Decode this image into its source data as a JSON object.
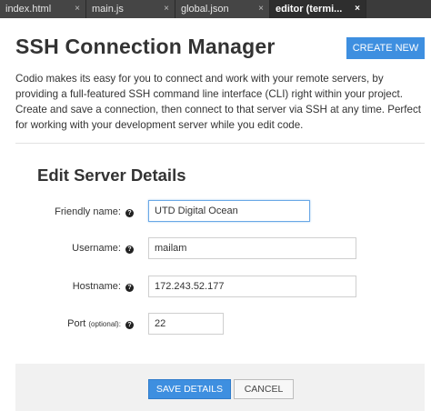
{
  "tabs": [
    {
      "label": "index.html",
      "close": "×",
      "active": false
    },
    {
      "label": "main.js",
      "close": "×",
      "active": false
    },
    {
      "label": "global.json",
      "close": "×",
      "active": false
    },
    {
      "label": "editor (termi...",
      "close": "×",
      "active": true
    }
  ],
  "header": {
    "title": "SSH Connection Manager",
    "create_label": "CREATE NEW"
  },
  "intro": "Codio makes its easy for you to connect and work with your remote servers, by providing a full-featured SSH command line interface (CLI) right within your project. Create and save a connection, then connect to that server via SSH at any time. Perfect for working with your development server while you edit code.",
  "form": {
    "title": "Edit Server Details",
    "help_glyph": "?",
    "friendly_name": {
      "label": "Friendly name:",
      "value": "UTD Digital Ocean"
    },
    "username": {
      "label": "Username:",
      "value": "mailam"
    },
    "hostname": {
      "label": "Hostname:",
      "value": "172.243.52.177"
    },
    "port": {
      "label": "Port",
      "hint": "(optional):",
      "value": "22"
    }
  },
  "footer": {
    "save_label": "SAVE DETAILS",
    "cancel_label": "CANCEL"
  }
}
